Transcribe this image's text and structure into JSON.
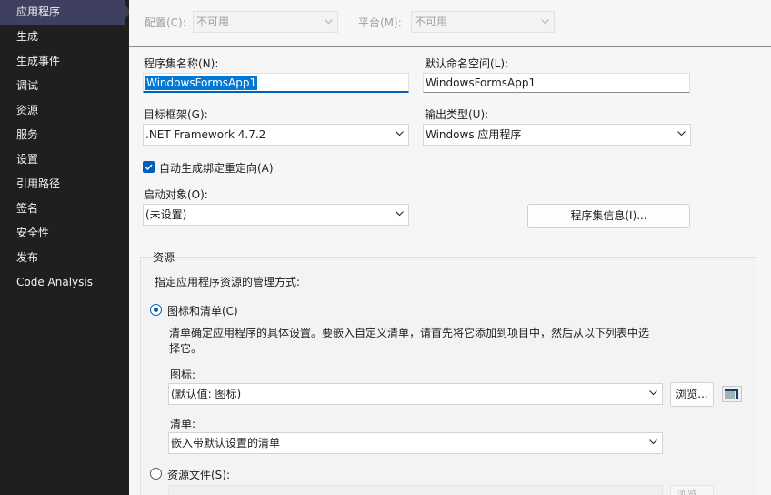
{
  "sidebar": {
    "items": [
      {
        "label": "应用程序",
        "active": true
      },
      {
        "label": "生成"
      },
      {
        "label": "生成事件"
      },
      {
        "label": "调试"
      },
      {
        "label": "资源"
      },
      {
        "label": "服务"
      },
      {
        "label": "设置"
      },
      {
        "label": "引用路径"
      },
      {
        "label": "签名"
      },
      {
        "label": "安全性"
      },
      {
        "label": "发布"
      },
      {
        "label": "Code Analysis"
      }
    ]
  },
  "topbar": {
    "config_label": "配置(C):",
    "config_value": "不可用",
    "platform_label": "平台(M):",
    "platform_value": "不可用"
  },
  "app": {
    "assembly_name_label": "程序集名称(N):",
    "assembly_name_value": "WindowsFormsApp1",
    "default_namespace_label": "默认命名空间(L):",
    "default_namespace_value": "WindowsFormsApp1",
    "target_framework_label": "目标框架(G):",
    "target_framework_value": ".NET Framework 4.7.2",
    "output_type_label": "输出类型(U):",
    "output_type_value": "Windows 应用程序",
    "auto_binding_label": "自动生成绑定重定向(A)",
    "auto_binding_checked": true,
    "startup_object_label": "启动对象(O):",
    "startup_object_value": "(未设置)",
    "assembly_info_button": "程序集信息(I)..."
  },
  "resources": {
    "group_title": "资源",
    "description": "指定应用程序资源的管理方式:",
    "option_icon_manifest": "图标和清单(C)",
    "option_icon_manifest_desc_line1": "清单确定应用程序的具体设置。要嵌入自定义清单，请首先将它添加到项目中，然后从以下列表中选",
    "option_icon_manifest_desc_line2": "择它。",
    "icon_label": "图标:",
    "icon_value": "(默认值: 图标)",
    "browse_button": "浏览...",
    "manifest_label": "清单:",
    "manifest_value": "嵌入带默认设置的清单",
    "option_resource_file": "资源文件(S):",
    "browse_button2": "浏览..."
  },
  "colors": {
    "sidebar_bg": "#1f1f1f",
    "accent": "#005fb8",
    "selection": "#0078d4"
  }
}
